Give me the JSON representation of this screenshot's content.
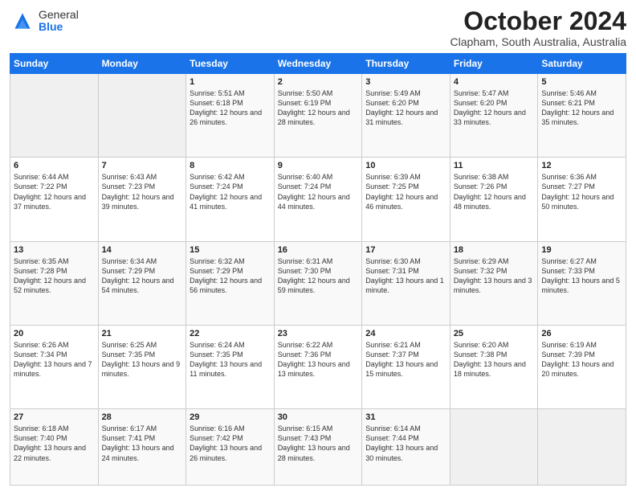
{
  "header": {
    "logo_general": "General",
    "logo_blue": "Blue",
    "month_title": "October 2024",
    "location": "Clapham, South Australia, Australia"
  },
  "days_of_week": [
    "Sunday",
    "Monday",
    "Tuesday",
    "Wednesday",
    "Thursday",
    "Friday",
    "Saturday"
  ],
  "weeks": [
    [
      {
        "day": "",
        "info": ""
      },
      {
        "day": "",
        "info": ""
      },
      {
        "day": "1",
        "info": "Sunrise: 5:51 AM\nSunset: 6:18 PM\nDaylight: 12 hours\nand 26 minutes."
      },
      {
        "day": "2",
        "info": "Sunrise: 5:50 AM\nSunset: 6:19 PM\nDaylight: 12 hours\nand 28 minutes."
      },
      {
        "day": "3",
        "info": "Sunrise: 5:49 AM\nSunset: 6:20 PM\nDaylight: 12 hours\nand 31 minutes."
      },
      {
        "day": "4",
        "info": "Sunrise: 5:47 AM\nSunset: 6:20 PM\nDaylight: 12 hours\nand 33 minutes."
      },
      {
        "day": "5",
        "info": "Sunrise: 5:46 AM\nSunset: 6:21 PM\nDaylight: 12 hours\nand 35 minutes."
      }
    ],
    [
      {
        "day": "6",
        "info": "Sunrise: 6:44 AM\nSunset: 7:22 PM\nDaylight: 12 hours\nand 37 minutes."
      },
      {
        "day": "7",
        "info": "Sunrise: 6:43 AM\nSunset: 7:23 PM\nDaylight: 12 hours\nand 39 minutes."
      },
      {
        "day": "8",
        "info": "Sunrise: 6:42 AM\nSunset: 7:24 PM\nDaylight: 12 hours\nand 41 minutes."
      },
      {
        "day": "9",
        "info": "Sunrise: 6:40 AM\nSunset: 7:24 PM\nDaylight: 12 hours\nand 44 minutes."
      },
      {
        "day": "10",
        "info": "Sunrise: 6:39 AM\nSunset: 7:25 PM\nDaylight: 12 hours\nand 46 minutes."
      },
      {
        "day": "11",
        "info": "Sunrise: 6:38 AM\nSunset: 7:26 PM\nDaylight: 12 hours\nand 48 minutes."
      },
      {
        "day": "12",
        "info": "Sunrise: 6:36 AM\nSunset: 7:27 PM\nDaylight: 12 hours\nand 50 minutes."
      }
    ],
    [
      {
        "day": "13",
        "info": "Sunrise: 6:35 AM\nSunset: 7:28 PM\nDaylight: 12 hours\nand 52 minutes."
      },
      {
        "day": "14",
        "info": "Sunrise: 6:34 AM\nSunset: 7:29 PM\nDaylight: 12 hours\nand 54 minutes."
      },
      {
        "day": "15",
        "info": "Sunrise: 6:32 AM\nSunset: 7:29 PM\nDaylight: 12 hours\nand 56 minutes."
      },
      {
        "day": "16",
        "info": "Sunrise: 6:31 AM\nSunset: 7:30 PM\nDaylight: 12 hours\nand 59 minutes."
      },
      {
        "day": "17",
        "info": "Sunrise: 6:30 AM\nSunset: 7:31 PM\nDaylight: 13 hours\nand 1 minute."
      },
      {
        "day": "18",
        "info": "Sunrise: 6:29 AM\nSunset: 7:32 PM\nDaylight: 13 hours\nand 3 minutes."
      },
      {
        "day": "19",
        "info": "Sunrise: 6:27 AM\nSunset: 7:33 PM\nDaylight: 13 hours\nand 5 minutes."
      }
    ],
    [
      {
        "day": "20",
        "info": "Sunrise: 6:26 AM\nSunset: 7:34 PM\nDaylight: 13 hours\nand 7 minutes."
      },
      {
        "day": "21",
        "info": "Sunrise: 6:25 AM\nSunset: 7:35 PM\nDaylight: 13 hours\nand 9 minutes."
      },
      {
        "day": "22",
        "info": "Sunrise: 6:24 AM\nSunset: 7:35 PM\nDaylight: 13 hours\nand 11 minutes."
      },
      {
        "day": "23",
        "info": "Sunrise: 6:22 AM\nSunset: 7:36 PM\nDaylight: 13 hours\nand 13 minutes."
      },
      {
        "day": "24",
        "info": "Sunrise: 6:21 AM\nSunset: 7:37 PM\nDaylight: 13 hours\nand 15 minutes."
      },
      {
        "day": "25",
        "info": "Sunrise: 6:20 AM\nSunset: 7:38 PM\nDaylight: 13 hours\nand 18 minutes."
      },
      {
        "day": "26",
        "info": "Sunrise: 6:19 AM\nSunset: 7:39 PM\nDaylight: 13 hours\nand 20 minutes."
      }
    ],
    [
      {
        "day": "27",
        "info": "Sunrise: 6:18 AM\nSunset: 7:40 PM\nDaylight: 13 hours\nand 22 minutes."
      },
      {
        "day": "28",
        "info": "Sunrise: 6:17 AM\nSunset: 7:41 PM\nDaylight: 13 hours\nand 24 minutes."
      },
      {
        "day": "29",
        "info": "Sunrise: 6:16 AM\nSunset: 7:42 PM\nDaylight: 13 hours\nand 26 minutes."
      },
      {
        "day": "30",
        "info": "Sunrise: 6:15 AM\nSunset: 7:43 PM\nDaylight: 13 hours\nand 28 minutes."
      },
      {
        "day": "31",
        "info": "Sunrise: 6:14 AM\nSunset: 7:44 PM\nDaylight: 13 hours\nand 30 minutes."
      },
      {
        "day": "",
        "info": ""
      },
      {
        "day": "",
        "info": ""
      }
    ]
  ]
}
